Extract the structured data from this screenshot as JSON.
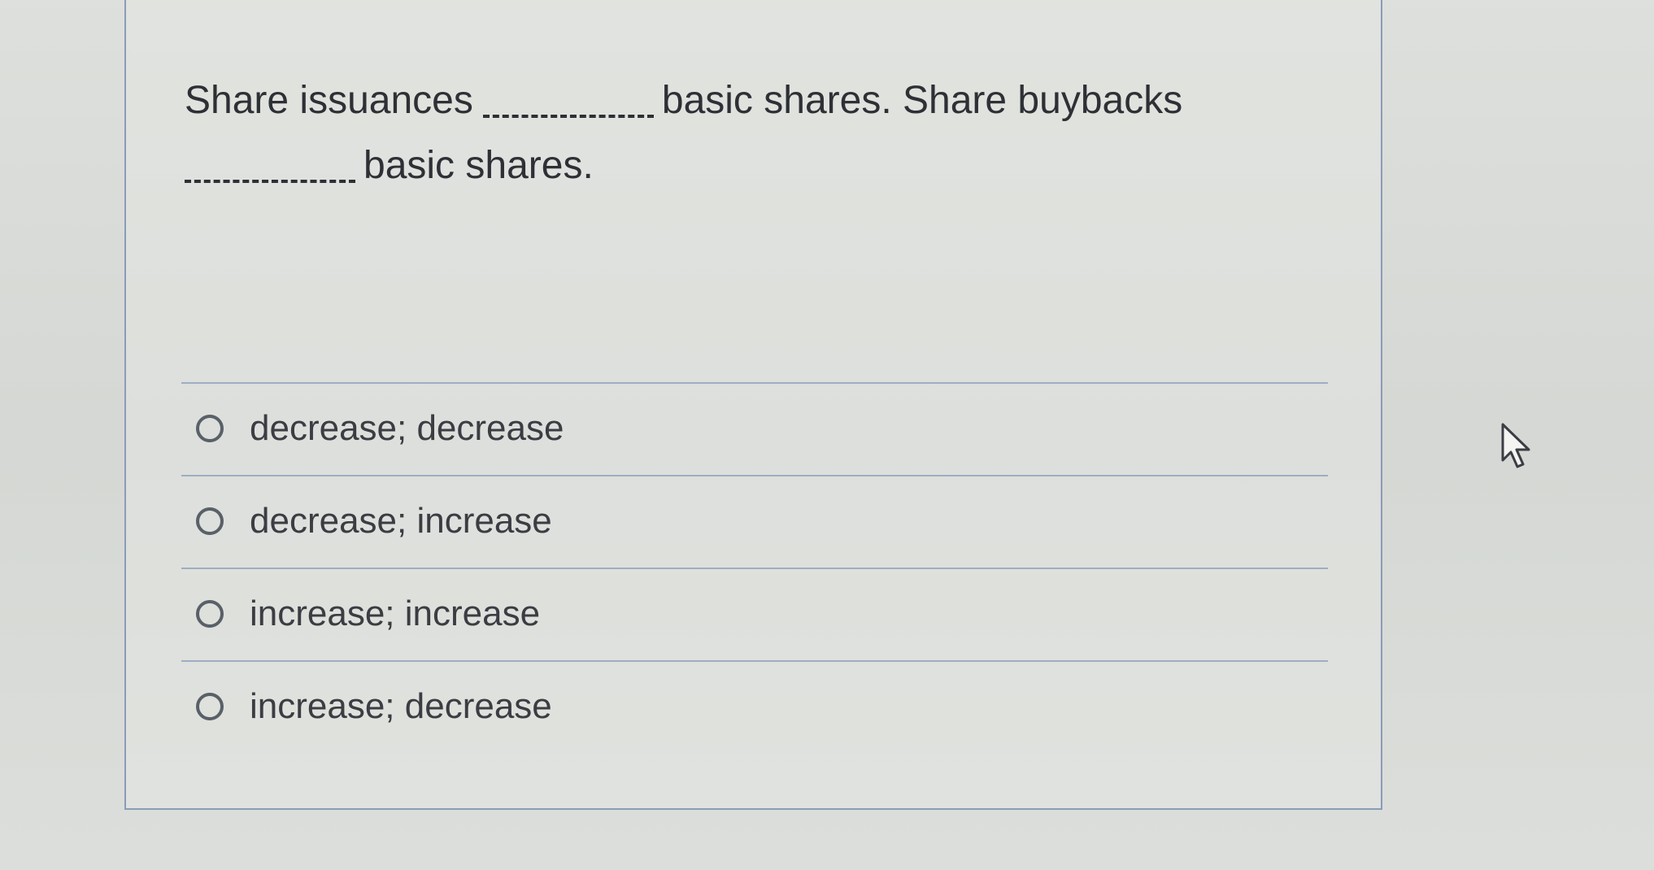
{
  "question": {
    "part1": "Share issuances",
    "part2": "basic shares. Share buybacks",
    "part3": "basic shares."
  },
  "options": [
    {
      "label": "decrease; decrease",
      "selected": false
    },
    {
      "label": "decrease; increase",
      "selected": false
    },
    {
      "label": "increase; increase",
      "selected": false
    },
    {
      "label": "increase; decrease",
      "selected": false
    }
  ],
  "cursor_icon": "mouse-pointer-icon"
}
